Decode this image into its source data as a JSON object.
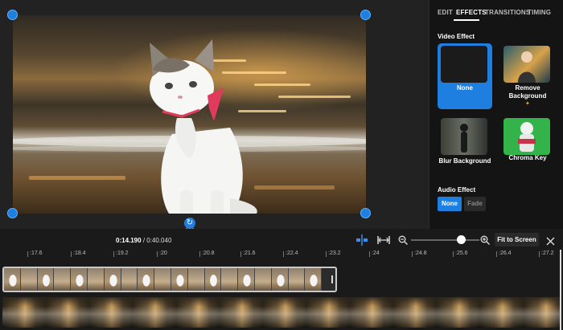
{
  "side_panel": {
    "tabs": [
      {
        "label": "EDIT",
        "active": false
      },
      {
        "label": "EFFECTS",
        "active": true
      },
      {
        "label": "TRANSITIONS",
        "active": false
      },
      {
        "label": "TIMING",
        "active": false
      }
    ],
    "video_effect": {
      "title": "Video Effect",
      "options": [
        {
          "label": "None",
          "selected": true
        },
        {
          "label": "Remove Background",
          "selected": false
        },
        {
          "label": "Blur Background",
          "selected": false
        },
        {
          "label": "Chroma Key",
          "selected": false
        }
      ]
    },
    "audio_effect": {
      "title": "Audio Effect",
      "options": [
        {
          "label": "None",
          "selected": true
        },
        {
          "label": "Fade",
          "selected": false
        }
      ]
    }
  },
  "timeline": {
    "current_time": "0:14.190",
    "total_time": "0:40.040",
    "fit_button": "Fit to Screen",
    "ruler_ticks": [
      ":17.6",
      ":18.4",
      ":19.2",
      ":20",
      ":20.8",
      ":21.6",
      ":22.4",
      ":23.2",
      ":24",
      ":24.8",
      ":25.6",
      ":26.4",
      ":27.2"
    ]
  },
  "colors": {
    "accent": "#1f7fe0",
    "panel_bg": "#141414",
    "app_bg": "#1a1a1a"
  }
}
